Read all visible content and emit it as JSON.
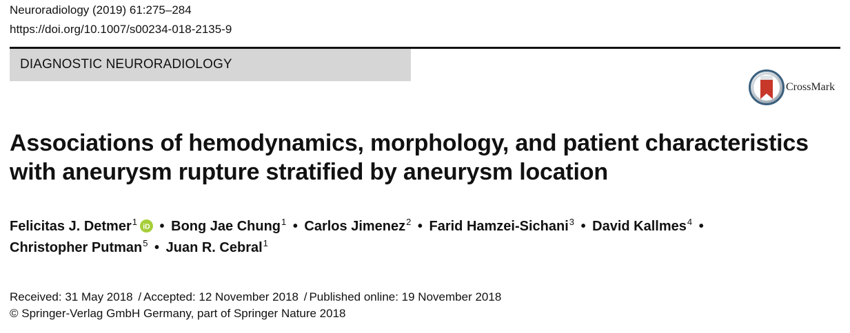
{
  "header": {
    "journal_ref": "Neuroradiology (2019) 61:275–284",
    "doi": "https://doi.org/10.1007/s00234-018-2135-9"
  },
  "section": {
    "label": "DIAGNOSTIC NEURORADIOLOGY"
  },
  "crossmark": {
    "label": "CrossMark",
    "icon": "crossmark-icon",
    "colors": {
      "ring": "#3a5f7d",
      "bookmark": "#c8382a"
    }
  },
  "article": {
    "title_line1": "Associations of hemodynamics, morphology, and patient characteristics",
    "title_line2": "with aneurysm rupture stratified by aneurysm location"
  },
  "authors": [
    {
      "name": "Felicitas J. Detmer",
      "affiliation": "1"
    },
    {
      "name": "Bong Jae Chung",
      "affiliation": "1"
    },
    {
      "name": "Carlos Jimenez",
      "affiliation": "2"
    },
    {
      "name": "Farid Hamzei-Sichani",
      "affiliation": "3"
    },
    {
      "name": "David Kallmes",
      "affiliation": "4"
    },
    {
      "name": "Christopher Putman",
      "affiliation": "5"
    },
    {
      "name": "Juan R. Cebral",
      "affiliation": "1"
    }
  ],
  "orcid": {
    "icon": "orcid-icon",
    "text": "iD",
    "color": "#a6ce39"
  },
  "separator": "•",
  "dates": {
    "received": "Received: 31 May 2018",
    "accepted": "Accepted: 12 November 2018",
    "published": "Published online: 19 November 2018",
    "slash": "/"
  },
  "copyright": {
    "symbol": "©",
    "text": "Springer-Verlag GmbH Germany, part of Springer Nature 2018"
  }
}
